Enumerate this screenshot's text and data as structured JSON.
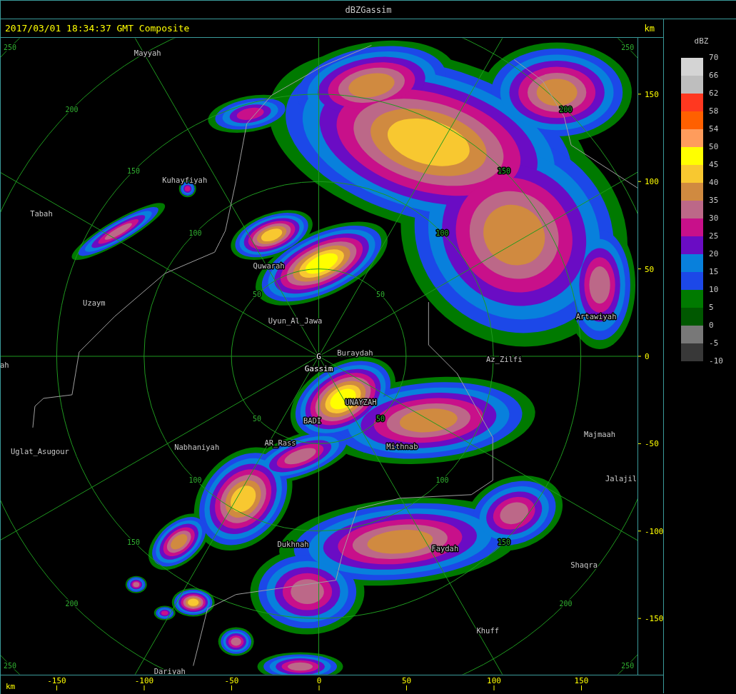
{
  "window": {
    "title": "dBZGassim"
  },
  "header": {
    "timestamp": "2017/03/01 18:34:37 GMT Composite",
    "unit": "km"
  },
  "map": {
    "site_marker": "G",
    "site_name": "Gassim",
    "places": [
      "Mayyah",
      "Kuhayfiyah",
      "Tabah",
      "Quwarah",
      "Uzaym",
      "Uyun_Al_Jawa",
      "Buraydah",
      "ah",
      "Az_Zilfi",
      "Artawiyah",
      "UNAYZAH",
      "BADI",
      "Majmaah",
      "Uglat_Asugour",
      "Nabhaniyah",
      "AR_Rass",
      "Mithnab",
      "Jalajil",
      "Dukhnah",
      "Faydah",
      "Shaqra",
      "Khuff",
      "Dariyah"
    ],
    "range_labels": [
      "50",
      "100",
      "150",
      "200",
      "250",
      "50",
      "100",
      "150",
      "200",
      "250",
      "50",
      "100",
      "150",
      "200",
      "250",
      "50",
      "100",
      "150",
      "200",
      "250"
    ]
  },
  "y_axis": {
    "ticks": [
      "150",
      "100",
      "50",
      "0",
      "-50",
      "-100",
      "-150"
    ]
  },
  "x_axis": {
    "unit": "km",
    "ticks": [
      "-150",
      "-100",
      "-50",
      "0",
      "50",
      "100",
      "150"
    ]
  },
  "legend": {
    "title": "dBZ",
    "bands": [
      {
        "color": "#d4d4d4"
      },
      {
        "color": "#bebebe"
      },
      {
        "color": "#ff3820"
      },
      {
        "color": "#ff6000"
      },
      {
        "color": "#ff9c5c"
      },
      {
        "color": "#ffff00"
      },
      {
        "color": "#f8c830"
      },
      {
        "color": "#d08a40"
      },
      {
        "color": "#bc6888"
      },
      {
        "color": "#c8108a"
      },
      {
        "color": "#6a0cc4"
      },
      {
        "color": "#0880dc"
      },
      {
        "color": "#1c48e8"
      },
      {
        "color": "#007a00"
      },
      {
        "color": "#005800"
      },
      {
        "color": "#787878"
      },
      {
        "color": "#383838"
      }
    ],
    "labels": [
      "70",
      "66",
      "62",
      "58",
      "54",
      "50",
      "45",
      "40",
      "35",
      "30",
      "25",
      "20",
      "15",
      "10",
      "5",
      "0",
      "-5",
      "-10"
    ]
  }
}
